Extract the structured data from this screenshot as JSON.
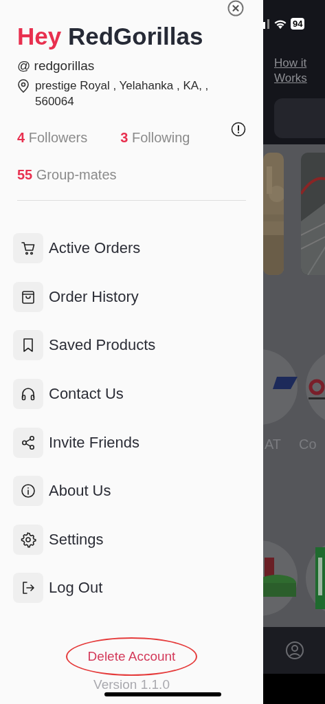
{
  "drawer": {
    "greeting": "Hey",
    "name": "RedGorillas",
    "handle": "@ redgorillas",
    "address": "prestige Royal , Yelahanka , KA, , 560064",
    "stats": [
      {
        "count": "4",
        "label": "Followers"
      },
      {
        "count": "3",
        "label": "Following"
      }
    ],
    "groupmates": {
      "count": "55",
      "label": "Group-mates"
    },
    "menu": [
      {
        "kind": "cart",
        "label": "Active Orders"
      },
      {
        "kind": "bag",
        "label": "Order History"
      },
      {
        "kind": "bookmark",
        "label": "Saved Products"
      },
      {
        "kind": "headphones",
        "label": "Contact Us"
      },
      {
        "kind": "share",
        "label": "Invite Friends"
      },
      {
        "kind": "info",
        "label": "About Us"
      },
      {
        "kind": "gear",
        "label": "Settings"
      },
      {
        "kind": "logout",
        "label": "Log Out"
      }
    ],
    "delete_account": "Delete Account",
    "version": "Version 1.1.0"
  },
  "background": {
    "battery": "94",
    "link": "How it Works",
    "brand_labels": [
      "AT",
      "Co"
    ]
  }
}
